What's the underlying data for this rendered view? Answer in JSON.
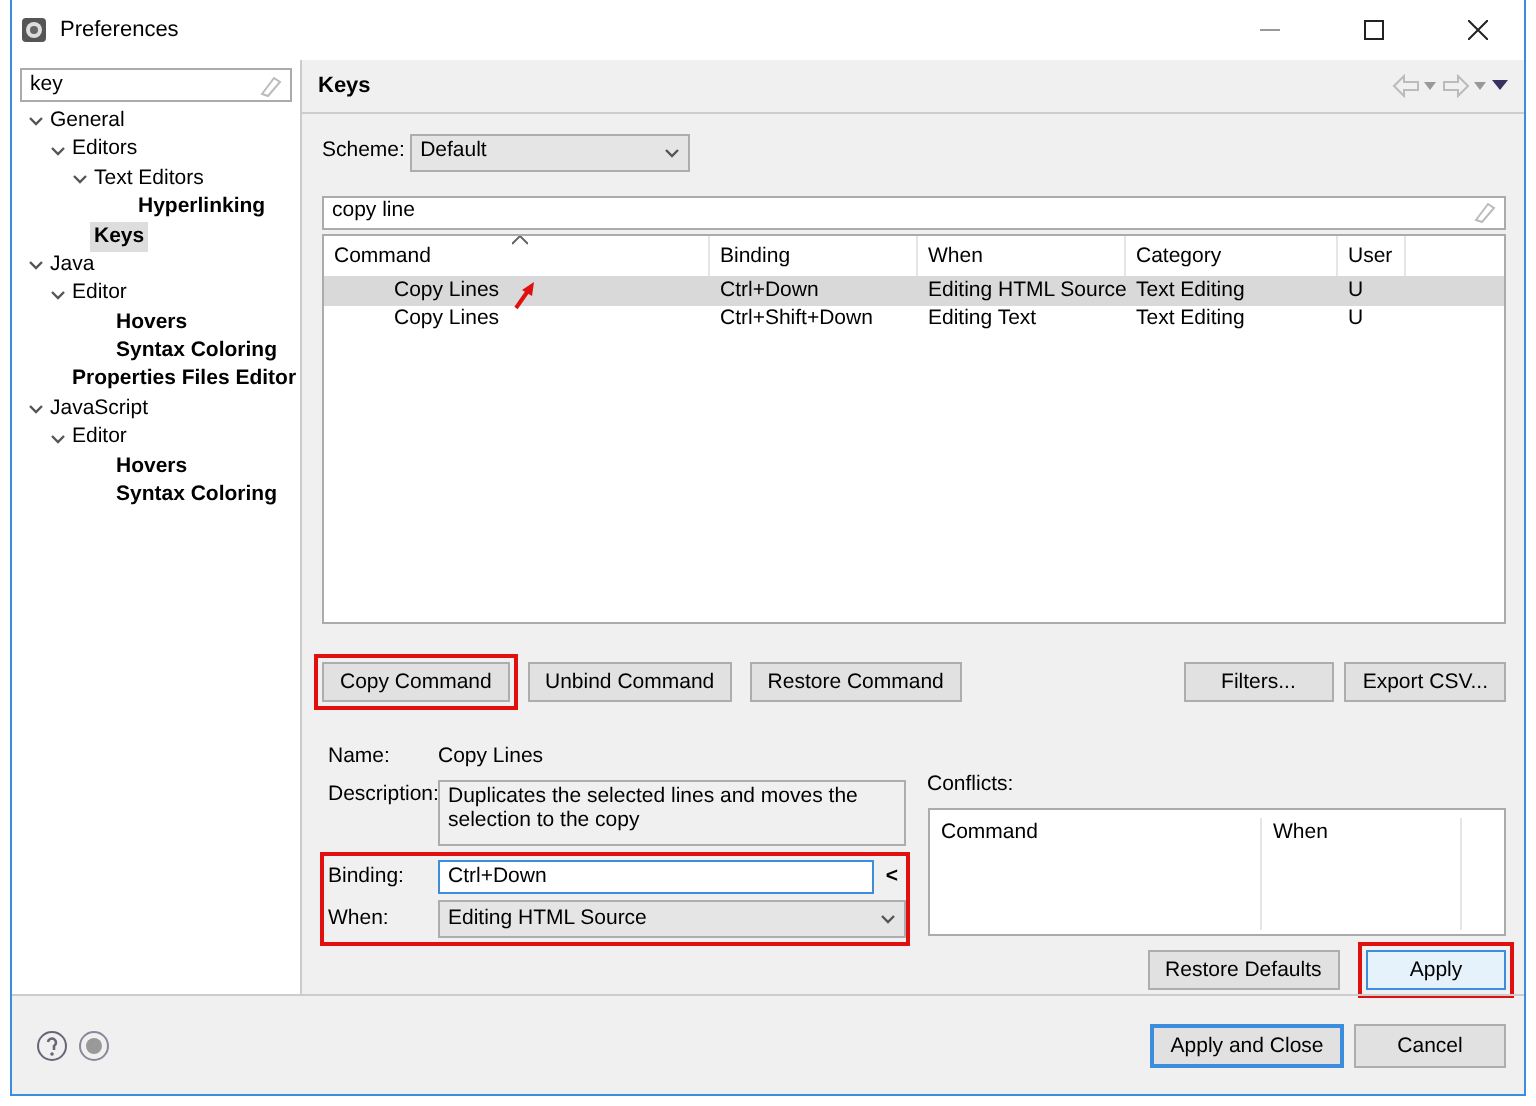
{
  "window": {
    "title": "Preferences"
  },
  "sidebar": {
    "filter": "key",
    "tree": [
      {
        "label": "General",
        "expanded": true,
        "matched": false,
        "selected": false,
        "children": [
          {
            "label": "Editors",
            "expanded": true,
            "matched": false,
            "selected": false,
            "children": [
              {
                "label": "Text Editors",
                "expanded": true,
                "matched": false,
                "selected": false,
                "children": [
                  {
                    "label": "Hyperlinking",
                    "matched": true,
                    "selected": false
                  }
                ]
              },
              {
                "label": "Keys",
                "matched": true,
                "selected": true
              }
            ]
          }
        ]
      },
      {
        "label": "Java",
        "expanded": true,
        "matched": false,
        "selected": false,
        "children": [
          {
            "label": "Editor",
            "expanded": true,
            "matched": false,
            "selected": false,
            "children": [
              {
                "label": "Hovers",
                "matched": true,
                "selected": false
              },
              {
                "label": "Syntax Coloring",
                "matched": true,
                "selected": false
              }
            ]
          },
          {
            "label": "Properties Files Editor",
            "matched": true,
            "selected": false
          }
        ]
      },
      {
        "label": "JavaScript",
        "expanded": true,
        "matched": false,
        "selected": false,
        "children": [
          {
            "label": "Editor",
            "expanded": true,
            "matched": false,
            "selected": false,
            "children": [
              {
                "label": "Hovers",
                "matched": true,
                "selected": false
              },
              {
                "label": "Syntax Coloring",
                "matched": true,
                "selected": false
              }
            ]
          }
        ]
      }
    ]
  },
  "page": {
    "title": "Keys",
    "scheme_label": "Scheme:",
    "scheme": "Default",
    "filter": "copy line",
    "table": {
      "columns": [
        "Command",
        "Binding",
        "When",
        "Category",
        "User"
      ],
      "rows": [
        {
          "cells": [
            "Copy Lines",
            "Ctrl+Down",
            "Editing HTML Source",
            "Text Editing",
            "U"
          ],
          "selected": true
        },
        {
          "cells": [
            "Copy Lines",
            "Ctrl+Shift+Down",
            "Editing Text",
            "Text Editing",
            "U"
          ],
          "selected": false
        }
      ]
    },
    "command_buttons": [
      {
        "label": "Copy Command",
        "highlighted": true
      },
      {
        "label": "Unbind Command",
        "highlighted": false
      },
      {
        "label": "Restore Command",
        "highlighted": false
      }
    ],
    "right_buttons": [
      "Filters...",
      "Export CSV..."
    ],
    "details": {
      "name_label": "Name:",
      "name": "Copy Lines",
      "description_label": "Description:",
      "description": "Duplicates the selected lines and moves the selection to the copy",
      "binding_label": "Binding:",
      "binding": "Ctrl+Down",
      "binding_button": "<",
      "when_label": "When:",
      "when": "Editing HTML Source",
      "highlighted": true
    },
    "conflicts": {
      "label": "Conflicts:",
      "columns": [
        "Command",
        "When"
      ]
    },
    "footer_buttons": [
      {
        "label": "Restore Defaults",
        "highlighted": false
      },
      {
        "label": "Apply",
        "highlighted": true
      }
    ]
  },
  "dialog_buttons": [
    {
      "label": "Apply and Close",
      "default": true
    },
    {
      "label": "Cancel",
      "default": false
    }
  ]
}
